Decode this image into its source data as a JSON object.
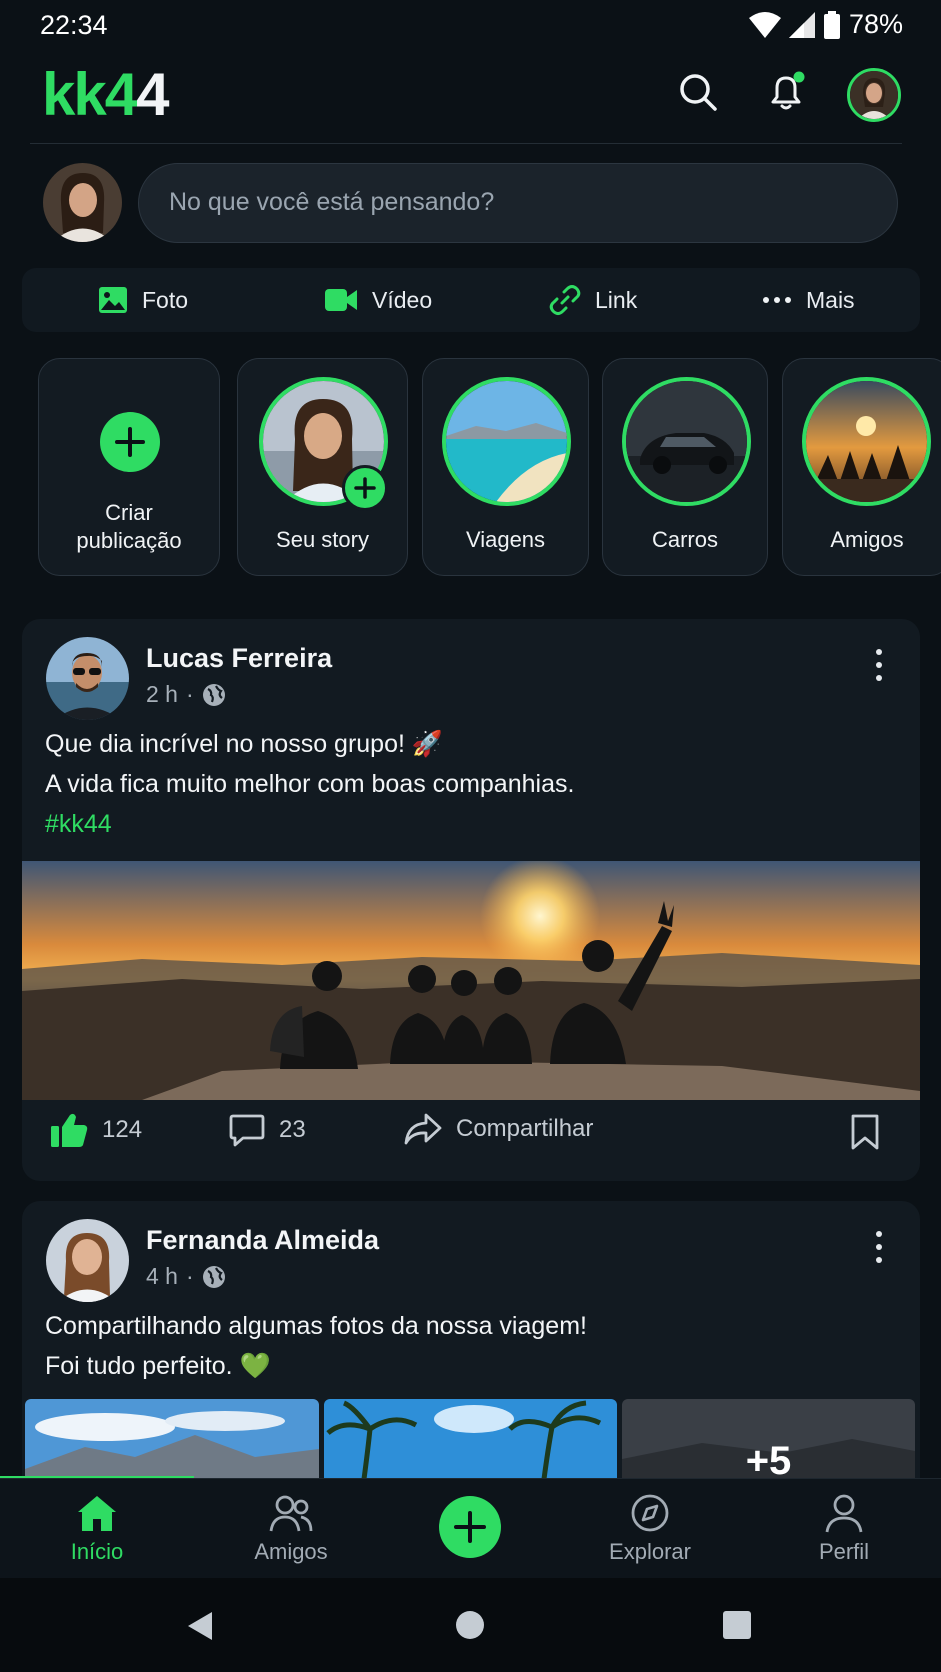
{
  "status_bar": {
    "time": "22:34",
    "battery": "78%"
  },
  "header": {
    "logo_part1": "kk",
    "logo_part2": "4",
    "logo_part3": "4"
  },
  "composer": {
    "placeholder": "No que você está pensando?",
    "actions": [
      {
        "label": "Foto",
        "icon": "image-icon"
      },
      {
        "label": "Vídeo",
        "icon": "video-icon"
      },
      {
        "label": "Link",
        "icon": "link-icon"
      },
      {
        "label": "Mais",
        "icon": "more-dots-icon"
      }
    ]
  },
  "stories": [
    {
      "label_line1": "Criar",
      "label_line2": "publicação"
    },
    {
      "label": "Seu story"
    },
    {
      "label": "Viagens"
    },
    {
      "label": "Carros"
    },
    {
      "label": "Amigos"
    }
  ],
  "posts": [
    {
      "author": "Lucas Ferreira",
      "time": "2 h",
      "text_line1": "Que dia incrível no nosso grupo! 🚀",
      "text_line2": "A vida fica muito melhor com boas companhias.",
      "hashtag": "#kk44",
      "likes": "124",
      "comments": "23",
      "share_label": "Compartilhar"
    },
    {
      "author": "Fernanda Almeida",
      "time": "4 h",
      "text_line1": "Compartilhando algumas fotos da nossa viagem!",
      "text_line2": "Foi tudo perfeito. 💚",
      "more_photos": "+5"
    }
  ],
  "bottom_nav": [
    {
      "label": "Início",
      "icon": "home-icon",
      "active": true
    },
    {
      "label": "Amigos",
      "icon": "friends-icon"
    },
    {
      "label": "Explorar",
      "icon": "compass-icon"
    },
    {
      "label": "Perfil",
      "icon": "profile-icon"
    }
  ],
  "colors": {
    "accent": "#2fdc63",
    "background": "#0b1116",
    "card": "#121a21"
  }
}
